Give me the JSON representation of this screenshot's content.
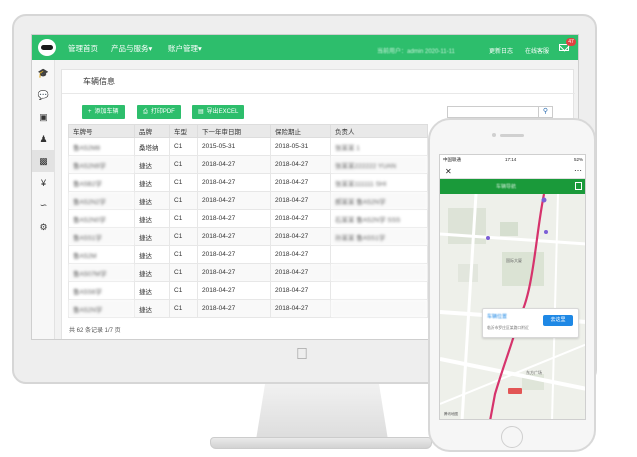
{
  "topbar": {
    "nav": [
      "管理首页",
      "产品与服务▾",
      "账户管理▾"
    ],
    "status_blurred": "当前用户：admin  2020-11-11",
    "links": [
      "更新日志",
      "在线客服"
    ],
    "mail_count": "47"
  },
  "sidebar": {
    "icons": [
      "graduation-cap-icon",
      "wechat-icon",
      "cube-icon",
      "users-icon",
      "car-icon",
      "yen-icon",
      "line-chart-icon",
      "gear-icon"
    ]
  },
  "panel": {
    "title": "车辆信息",
    "buttons": {
      "add": "添加车辆",
      "print": "打印PDF",
      "export": "导出EXCEL"
    },
    "search_placeholder": ""
  },
  "table": {
    "headers": [
      "车牌号",
      "品牌",
      "车型",
      "下一年审日期",
      "保险期止",
      "负责人"
    ],
    "rows": [
      {
        "plate": "鲁A52M8",
        "brand": "桑塔纳",
        "type": "C1",
        "review": "2015-05-31",
        "insurance": "2018-05-31",
        "owner": "张某某 1"
      },
      {
        "plate": "鲁A52N9学",
        "brand": "捷达",
        "type": "C1",
        "review": "2018-04-27",
        "insurance": "2018-04-27",
        "owner": "张某某222222 YUAN"
      },
      {
        "plate": "鲁A5B2学",
        "brand": "捷达",
        "type": "C1",
        "review": "2018-04-27",
        "insurance": "2018-04-27",
        "owner": "张某某111111 SHI"
      },
      {
        "plate": "鲁A52N2学",
        "brand": "捷达",
        "type": "C1",
        "review": "2018-04-27",
        "insurance": "2018-04-27",
        "owner": "郝某某 鲁A52N学"
      },
      {
        "plate": "鲁A52N0学",
        "brand": "捷达",
        "type": "C1",
        "review": "2018-04-27",
        "insurance": "2018-04-27",
        "owner": "石某某 鲁A52N学 SSS"
      },
      {
        "plate": "鲁A5S1学",
        "brand": "捷达",
        "type": "C1",
        "review": "2018-04-27",
        "insurance": "2018-04-27",
        "owner": "孙某某 鲁A5S1学"
      },
      {
        "plate": "鲁A52M",
        "brand": "捷达",
        "type": "C1",
        "review": "2018-04-27",
        "insurance": "2018-04-27",
        "owner": ""
      },
      {
        "plate": "鲁A507M学",
        "brand": "捷达",
        "type": "C1",
        "review": "2018-04-27",
        "insurance": "2018-04-27",
        "owner": ""
      },
      {
        "plate": "鲁A5S6学",
        "brand": "捷达",
        "type": "C1",
        "review": "2018-04-27",
        "insurance": "2018-04-27",
        "owner": ""
      },
      {
        "plate": "鲁A52N学",
        "brand": "捷达",
        "type": "C1",
        "review": "2018-04-27",
        "insurance": "2018-04-27",
        "owner": ""
      }
    ]
  },
  "pager": "共 62 条记录 1/7 页",
  "phone": {
    "carrier": "中国联通",
    "time": "17:14",
    "battery": "52%",
    "title": "车辆导航",
    "popup_title": "车辆位置",
    "popup_address": "临沂市罗庄区某路口附近",
    "go_label": "去这里",
    "brand_mark": "腾讯地图",
    "places": [
      "国际大厦",
      "金雀山路",
      "东方广场"
    ]
  },
  "colors": {
    "green": "#2dbe6c",
    "phone_green": "#1a9a3a",
    "route": "#d6336c",
    "blue": "#1e88e5"
  }
}
